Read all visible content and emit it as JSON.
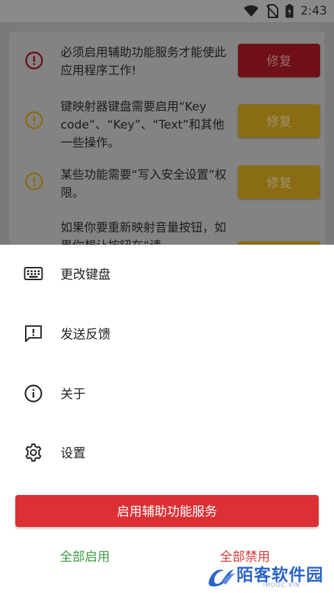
{
  "status_bar": {
    "time": "2:43",
    "icons": [
      "wifi-icon",
      "no-sim-icon",
      "battery-charging-icon"
    ]
  },
  "issues": [
    {
      "text": "必须启用辅助功能服务才能使此应用程序工作!",
      "icon": "error-circle-icon",
      "fix_label": "修复",
      "severity": "error",
      "color": "#6e1016"
    },
    {
      "text": "键映射器键盘需要启用“Key code”、“Key”、“Text”和其他一些操作。",
      "icon": "warning-circle-icon",
      "fix_label": "修复",
      "severity": "warning",
      "color": "#8a6c14"
    },
    {
      "text": "某些功能需要“写入安全设置”权限。",
      "icon": "warning-circle-icon",
      "fix_label": "修复",
      "severity": "warning",
      "color": "#8a6c14"
    },
    {
      "text": "如果你要重新映射音量按钮，如果你想让按钮在“请",
      "icon": "",
      "fix_label": "",
      "severity": "warning",
      "color": "#8a6c14"
    }
  ],
  "menu": [
    {
      "label": "更改键盘",
      "icon": "keyboard-icon"
    },
    {
      "label": "发送反馈",
      "icon": "feedback-icon"
    },
    {
      "label": "关于",
      "icon": "info-icon"
    },
    {
      "label": "设置",
      "icon": "settings-gear-icon"
    }
  ],
  "primary_button": {
    "label": "启用辅助功能服务",
    "color": "#dc3035"
  },
  "enable_all": {
    "label": "全部启用",
    "color": "#3c9a45"
  },
  "disable_all": {
    "label": "全部禁用",
    "color": "#d63a3a"
  },
  "watermark": {
    "title": "陌客软件园",
    "subtitle": "IMOOC.XIN"
  }
}
